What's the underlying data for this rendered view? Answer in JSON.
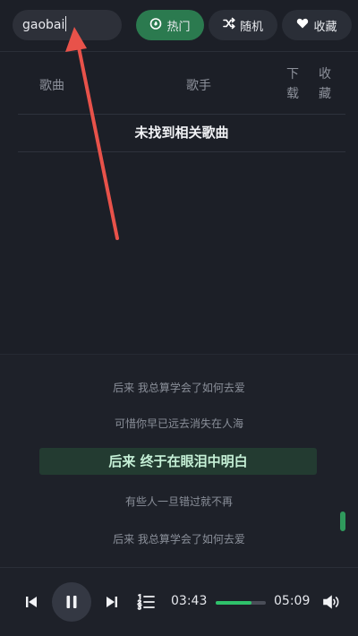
{
  "search": {
    "value": "gaobai"
  },
  "tabs": [
    {
      "label": "热门",
      "icon": "flame-icon",
      "active": true
    },
    {
      "label": "随机",
      "icon": "shuffle-icon",
      "active": false
    },
    {
      "label": "收藏",
      "icon": "heart-icon",
      "active": false
    }
  ],
  "table": {
    "columns": {
      "song": "歌曲",
      "singer": "歌手",
      "download": "下载",
      "favorite": "收藏"
    },
    "empty_message": "未找到相关歌曲"
  },
  "lyrics": {
    "lines": [
      "后来 我总算学会了如何去爱",
      "可惜你早已远去消失在人海",
      "后来 终于在眼泪中明白",
      "有些人一旦错过就不再",
      "后来 我总算学会了如何去爱"
    ],
    "current_index": 2
  },
  "player": {
    "current_time": "03:43",
    "total_time": "05:09",
    "progress_fraction": 0.72
  },
  "colors": {
    "accent": "#2fc26b",
    "active_tab": "#2b7a4f",
    "background": "#1c1f27",
    "annotation_arrow": "#e8524a"
  }
}
